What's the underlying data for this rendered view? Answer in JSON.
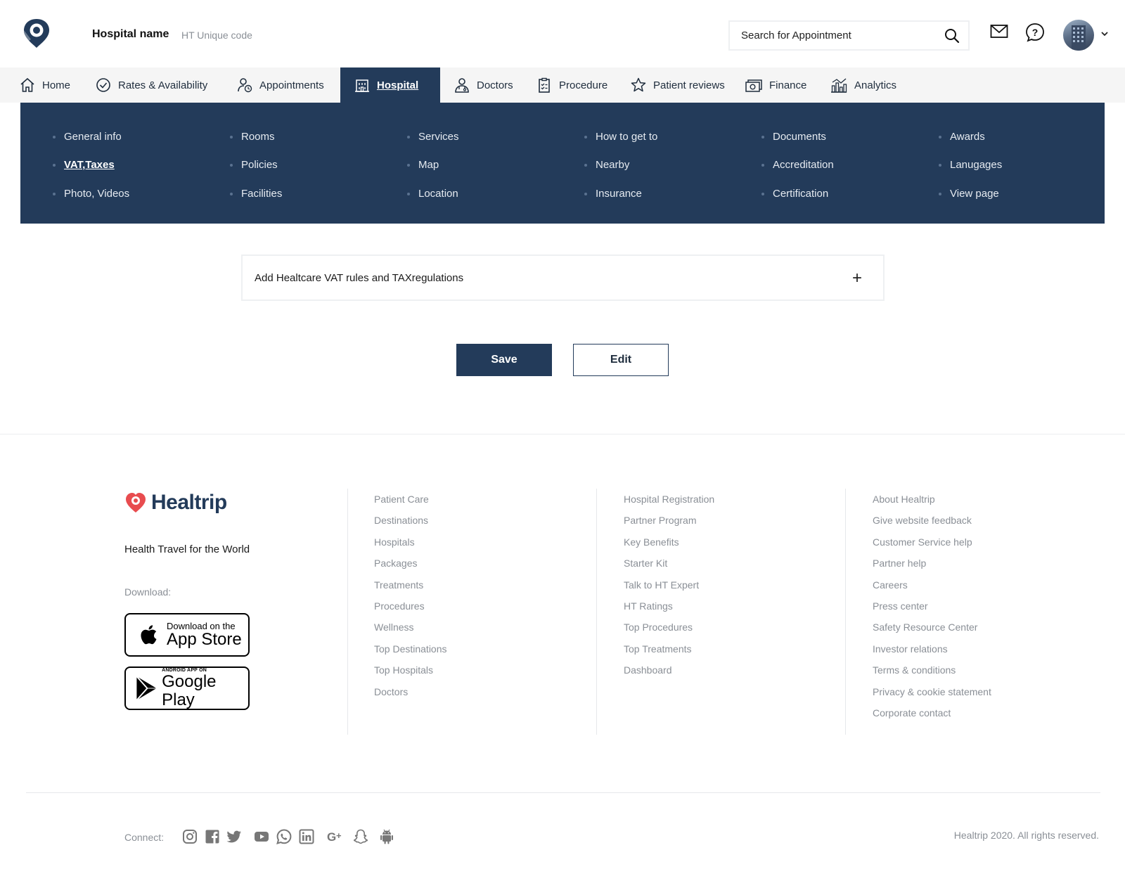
{
  "header": {
    "hospital_name": "Hospital name",
    "hospital_code": "HT Unique code",
    "search_placeholder": "Search for Appointment"
  },
  "nav": {
    "items": [
      {
        "label": "Home",
        "icon": "home-icon"
      },
      {
        "label": "Rates & Availability",
        "icon": "check-circle-icon"
      },
      {
        "label": "Appointments",
        "icon": "user-clock-icon"
      },
      {
        "label": "Hospital",
        "icon": "building-icon",
        "active": true
      },
      {
        "label": "Doctors",
        "icon": "doctor-icon"
      },
      {
        "label": "Procedure",
        "icon": "clipboard-icon"
      },
      {
        "label": "Patient reviews",
        "icon": "star-icon"
      },
      {
        "label": "Finance",
        "icon": "money-icon"
      },
      {
        "label": "Analytics",
        "icon": "analytics-icon"
      }
    ]
  },
  "submenu": {
    "columns": [
      [
        "General info",
        "VAT,Taxes",
        "Photo, Videos"
      ],
      [
        "Rooms",
        "Policies",
        "Facilities"
      ],
      [
        "Services",
        "Map",
        "Location"
      ],
      [
        "How to get to",
        "Nearby",
        "Insurance"
      ],
      [
        "Documents",
        "Accreditation",
        "Certification"
      ],
      [
        "Awards",
        "Lanugages",
        "View page"
      ]
    ],
    "active": "VAT,Taxes"
  },
  "content": {
    "vat_label": "Add Healtcare VAT rules and TAXregulations",
    "add_symbol": "+",
    "save_label": "Save",
    "edit_label": "Edit"
  },
  "footer": {
    "brand": "Healtrip",
    "tagline": "Health Travel for the World",
    "download_label": "Download:",
    "appstore_small": "Download on the",
    "appstore_big": "App Store",
    "google_small": "ANDROID APP ON",
    "google_big": "Google Play",
    "col1": [
      "Patient Care",
      "Destinations",
      "Hospitals",
      "Packages",
      "Treatments",
      "Procedures",
      "Wellness",
      "Top Destinations",
      "Top Hospitals",
      "Doctors"
    ],
    "col2": [
      "Hospital Registration",
      "Partner Program",
      "Key Benefits",
      "Starter Kit",
      "Talk to HT Expert",
      "HT Ratings",
      "Top Procedures",
      "Top Treatments",
      "Dashboard"
    ],
    "col3": [
      "About Healtrip",
      "Give website feedback",
      "Customer Service help",
      "Partner help",
      "Careers",
      "Press center",
      "Safety Resource Center",
      "Investor relations",
      "Terms & conditions",
      "Privacy & cookie statement",
      "Corporate contact"
    ],
    "connect_label": "Connect:",
    "copyright": "Healtrip 2020. All rights reserved."
  },
  "colors": {
    "primary": "#233b5a",
    "brand_red": "#e84c4f",
    "muted": "#8a8f96"
  }
}
